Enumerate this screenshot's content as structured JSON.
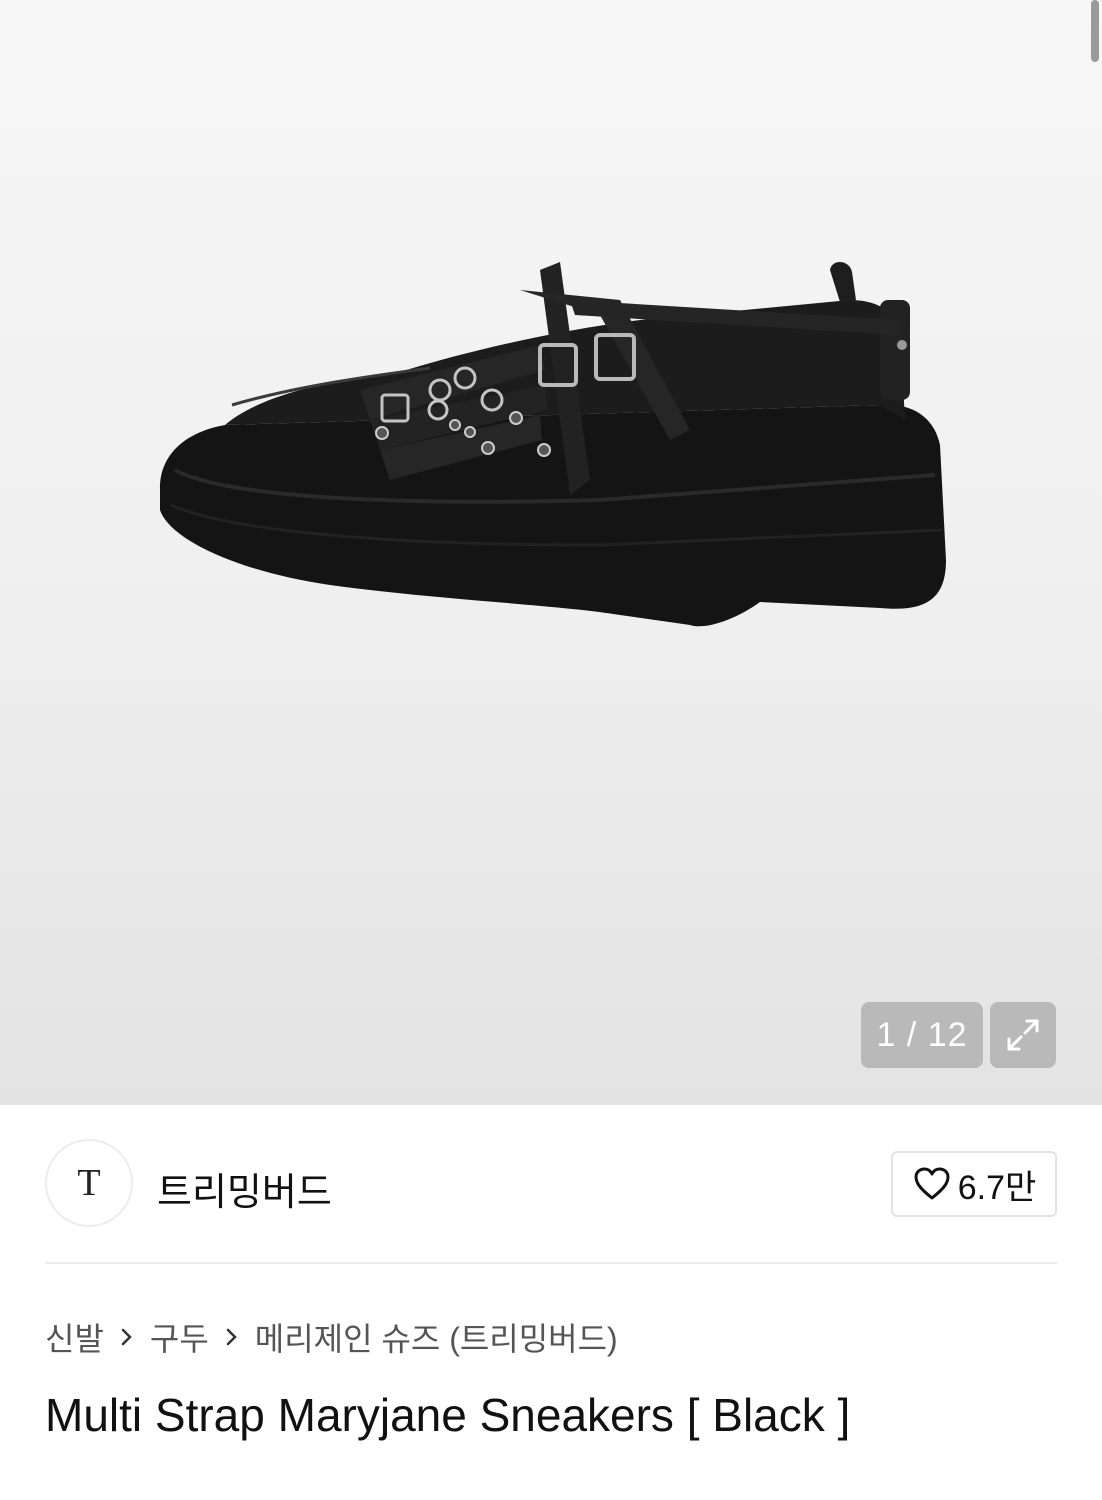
{
  "gallery": {
    "current": "1",
    "total": "12",
    "counter_text": "1 / 12",
    "image_alt": "Multi Strap Maryjane Sneakers black platform shoe"
  },
  "brand": {
    "logo_text": "T",
    "name": "트리밍버드"
  },
  "like": {
    "icon": "heart-icon",
    "count": "6.7만"
  },
  "breadcrumb": {
    "items": [
      "신발",
      "구두",
      "메리제인 슈즈 (트리밍버드)"
    ]
  },
  "product": {
    "title": "Multi Strap Maryjane Sneakers [ Black ]"
  },
  "colors": {
    "gallery_bg": "#efefef",
    "counter_bg": "#969696",
    "text": "#111111",
    "muted": "#555555",
    "border": "#e2e2e2"
  }
}
